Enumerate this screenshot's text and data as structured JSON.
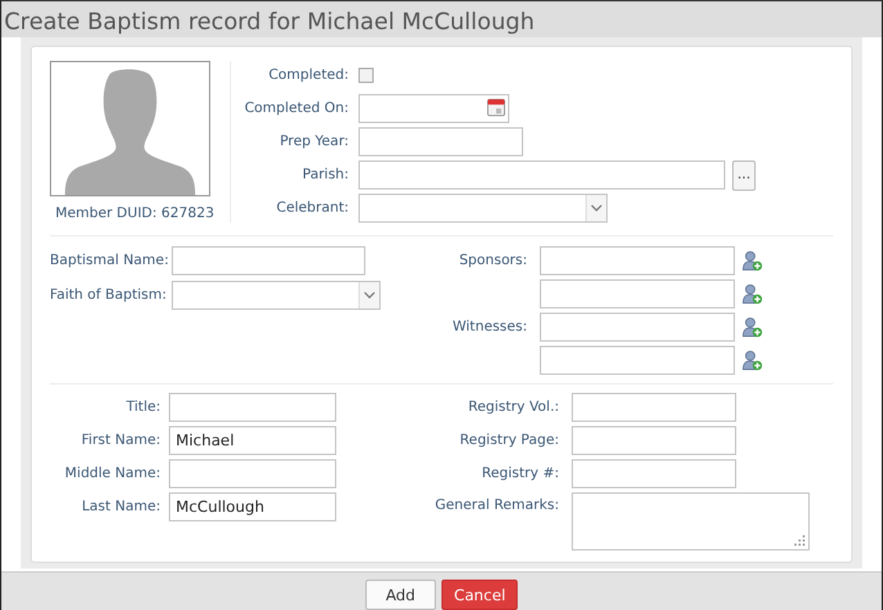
{
  "window": {
    "title": "Create Baptism record for Michael McCullough"
  },
  "member": {
    "caption": "Member DUID: 627823"
  },
  "top_fields": [
    {
      "label": "Completed:",
      "kind": "checkbox",
      "checked": false
    },
    {
      "label": "Completed On:",
      "kind": "date"
    },
    {
      "label": "Prep Year:",
      "kind": "text"
    },
    {
      "label": "Parish:",
      "kind": "lookup",
      "button": "..."
    },
    {
      "label": "Celebrant:",
      "kind": "select"
    }
  ],
  "baptism_fields": [
    {
      "label": "Baptismal Name:",
      "kind": "text"
    },
    {
      "label": "Faith of Baptism:",
      "kind": "select"
    }
  ],
  "people_fields": [
    {
      "label": "Sponsors:",
      "kind": "person"
    },
    {
      "kind": "person"
    },
    {
      "label": "Witnesses:",
      "kind": "person"
    },
    {
      "kind": "person"
    }
  ],
  "name_fields": [
    {
      "label": "Title:"
    },
    {
      "label": "First Name:",
      "value": "Michael"
    },
    {
      "label": "Middle Name:"
    },
    {
      "label": "Last Name:",
      "value": "McCullough"
    }
  ],
  "registry_fields": [
    {
      "label": "Registry Vol.:",
      "kind": "text"
    },
    {
      "label": "Registry Page:",
      "kind": "text"
    },
    {
      "label": "Registry #:",
      "kind": "text"
    },
    {
      "label": "General Remarks:",
      "kind": "textarea"
    }
  ],
  "buttons": [
    {
      "label": "Add",
      "kind": "default"
    },
    {
      "label": "Cancel",
      "kind": "danger"
    }
  ]
}
